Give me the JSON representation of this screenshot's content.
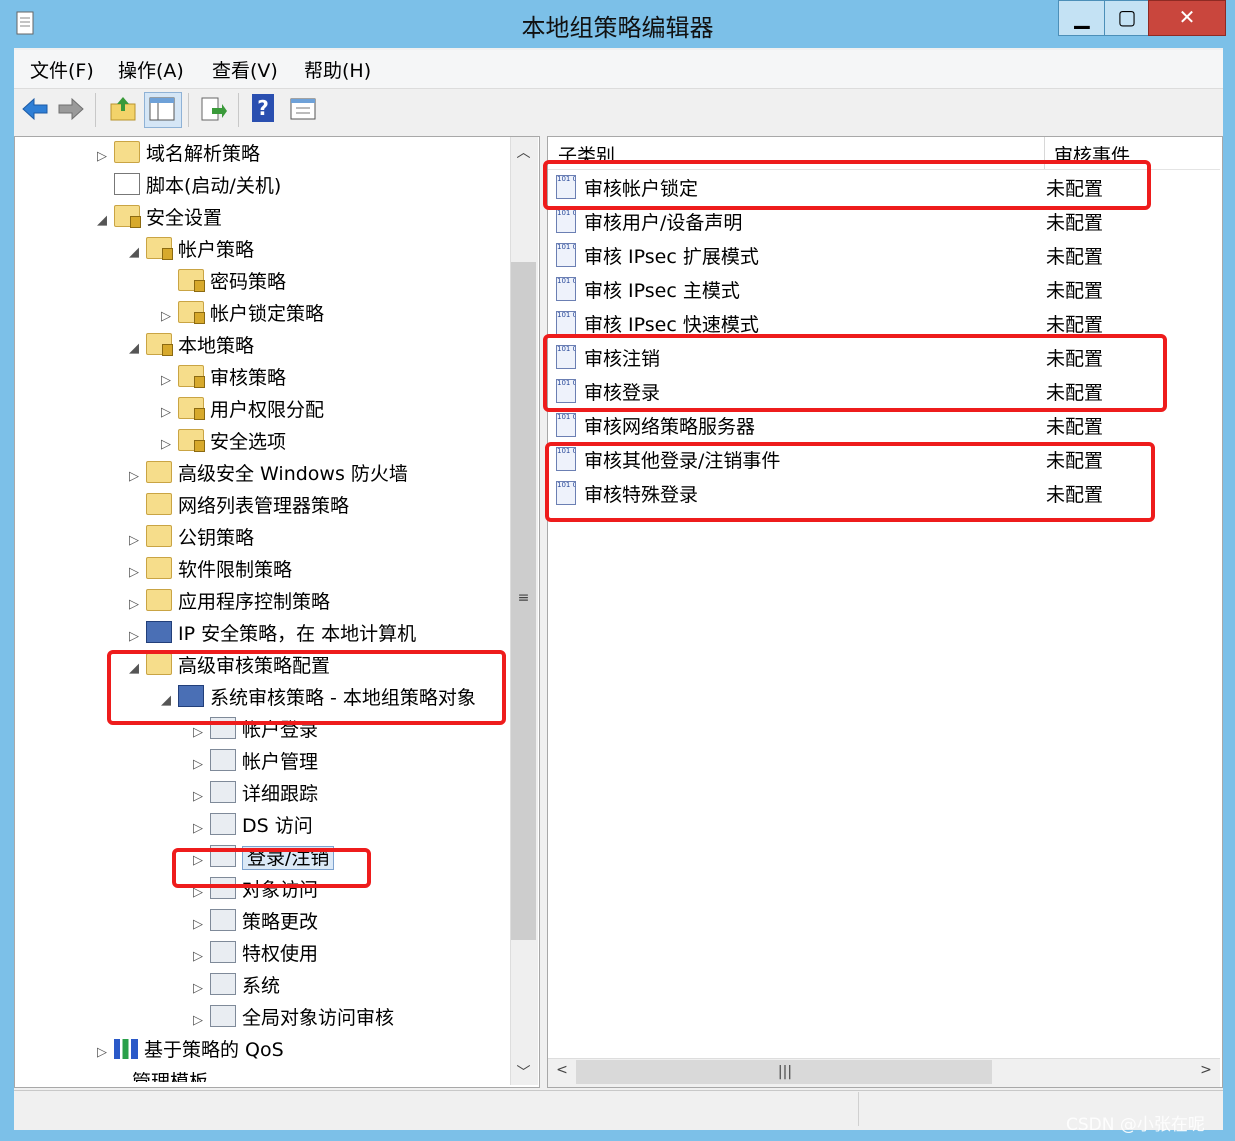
{
  "window": {
    "title": "本地组策略编辑器",
    "min_label": "▁",
    "max_label": "▢",
    "close_label": "✕"
  },
  "menu": [
    "文件(F)",
    "操作(A)",
    "查看(V)",
    "帮助(H)"
  ],
  "toolbar": {
    "icons": [
      "back-icon",
      "forward-icon",
      "up-folder-icon",
      "show-hide-tree-icon",
      "export-list-icon",
      "help-icon",
      "properties-icon"
    ],
    "help_glyph": "?"
  },
  "tree": {
    "items": [
      {
        "label": "域名解析策略",
        "arrow": "▷",
        "icon": "folder"
      },
      {
        "label": "脚本(启动/关机)",
        "arrow": "",
        "icon": "script"
      },
      {
        "label": "安全设置",
        "arrow": "◢",
        "icon": "lockfolder"
      },
      {
        "label": "帐户策略",
        "arrow": "◢",
        "icon": "lockfolder"
      },
      {
        "label": "密码策略",
        "arrow": "",
        "icon": "lockfolder"
      },
      {
        "label": "帐户锁定策略",
        "arrow": "▷",
        "icon": "lockfolder"
      },
      {
        "label": "本地策略",
        "arrow": "◢",
        "icon": "lockfolder"
      },
      {
        "label": "审核策略",
        "arrow": "▷",
        "icon": "lockfolder"
      },
      {
        "label": "用户权限分配",
        "arrow": "▷",
        "icon": "lockfolder"
      },
      {
        "label": "安全选项",
        "arrow": "▷",
        "icon": "lockfolder"
      },
      {
        "label": "高级安全 Windows 防火墙",
        "arrow": "▷",
        "icon": "folder"
      },
      {
        "label": "网络列表管理器策略",
        "arrow": "",
        "icon": "folder"
      },
      {
        "label": "公钥策略",
        "arrow": "▷",
        "icon": "folder"
      },
      {
        "label": "软件限制策略",
        "arrow": "▷",
        "icon": "folder"
      },
      {
        "label": "应用程序控制策略",
        "arrow": "▷",
        "icon": "folder"
      },
      {
        "label": "IP 安全策略，在 本地计算机",
        "arrow": "▷",
        "icon": "computer"
      },
      {
        "label": "高级审核策略配置",
        "arrow": "◢",
        "icon": "folder"
      },
      {
        "label": "系统审核策略 - 本地组策略对象",
        "arrow": "◢",
        "icon": "computer"
      },
      {
        "label": "帐户登录",
        "arrow": "▷",
        "icon": "policy"
      },
      {
        "label": "帐户管理",
        "arrow": "▷",
        "icon": "policy"
      },
      {
        "label": "详细跟踪",
        "arrow": "▷",
        "icon": "policy"
      },
      {
        "label": "DS 访问",
        "arrow": "▷",
        "icon": "policy"
      },
      {
        "label": "登录/注销",
        "arrow": "▷",
        "icon": "policy"
      },
      {
        "label": "对象访问",
        "arrow": "▷",
        "icon": "policy"
      },
      {
        "label": "策略更改",
        "arrow": "▷",
        "icon": "policy"
      },
      {
        "label": "特权使用",
        "arrow": "▷",
        "icon": "policy"
      },
      {
        "label": "系统",
        "arrow": "▷",
        "icon": "policy"
      },
      {
        "label": "全局对象访问审核",
        "arrow": "▷",
        "icon": "policy"
      },
      {
        "label": "基于策略的 QoS",
        "arrow": "▷",
        "icon": "chart"
      }
    ],
    "partial_bottom_label": "管理模板"
  },
  "list": {
    "columns": [
      "子类别",
      "审核事件"
    ],
    "icon_glyph": "101\n010",
    "rows": [
      {
        "name": "审核帐户锁定",
        "status": "未配置"
      },
      {
        "name": "审核用户/设备声明",
        "status": "未配置"
      },
      {
        "name": "审核 IPsec 扩展模式",
        "status": "未配置"
      },
      {
        "name": "审核 IPsec 主模式",
        "status": "未配置"
      },
      {
        "name": "审核 IPsec 快速模式",
        "status": "未配置"
      },
      {
        "name": "审核注销",
        "status": "未配置"
      },
      {
        "name": "审核登录",
        "status": "未配置"
      },
      {
        "name": "审核网络策略服务器",
        "status": "未配置"
      },
      {
        "name": "审核其他登录/注销事件",
        "status": "未配置"
      },
      {
        "name": "审核特殊登录",
        "status": "未配置"
      }
    ]
  },
  "scroll": {
    "up": "︿",
    "down": "﹀",
    "left": "<",
    "right": ">",
    "grip": "≡",
    "hgrip": "|||"
  },
  "watermark": "CSDN @小张在呢",
  "colors": {
    "highlight": "#ee1c1c",
    "title_bar": "#7cc0e8",
    "close_button": "#c9463d"
  }
}
